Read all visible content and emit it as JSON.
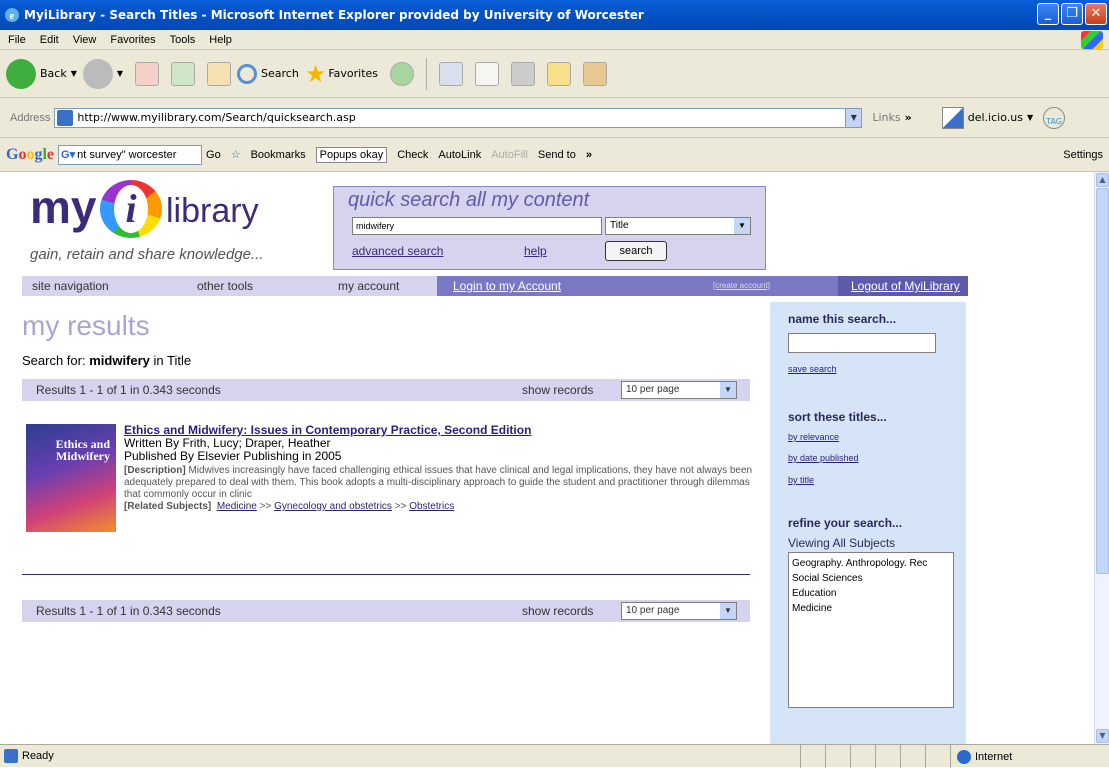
{
  "window": {
    "title": "MyiLibrary - Search Titles - Microsoft Internet Explorer provided by University of Worcester"
  },
  "menu": [
    "File",
    "Edit",
    "View",
    "Favorites",
    "Tools",
    "Help"
  ],
  "toolbar": {
    "back": "Back",
    "search": "Search",
    "favorites": "Favorites"
  },
  "address": {
    "label": "Address",
    "url": "http://www.myilibrary.com/Search/quicksearch.asp",
    "links": "Links",
    "delicious": "del.icio.us",
    "tag": "TAG"
  },
  "googlebar": {
    "logo": "Google",
    "query": "nt survey\" worcester",
    "go": "Go",
    "bookmarks": "Bookmarks",
    "popups": "Popups okay",
    "check": "Check",
    "autolink": "AutoLink",
    "autofill": "AutoFill",
    "sendto": "Send to",
    "settings": "Settings"
  },
  "logo": {
    "my": "my",
    "i": "i",
    "library": "library",
    "tagline": "gain, retain and share knowledge..."
  },
  "quicksearch": {
    "title": "quick search all my content",
    "query": "midwifery",
    "field": "Title",
    "advanced": "advanced search",
    "help": "help",
    "button": "search"
  },
  "nav": {
    "site": "site navigation",
    "tools": "other tools",
    "account": "my account",
    "login": "Login to my Account",
    "create": "[create account]",
    "logout": "Logout of MyiLibrary"
  },
  "results": {
    "heading": "my results",
    "search_prefix": "Search for:",
    "search_term": "midwifery",
    "search_suffix": "in Title",
    "summary": "Results 1 - 1 of 1 in 0.343 seconds",
    "show_records": "show records",
    "per_page": "10 per page"
  },
  "item": {
    "cover": "Ethics and Midwifery",
    "title": "Ethics and Midwifery: Issues in Contemporary Practice, Second Edition",
    "author": "Written By Frith, Lucy; Draper, Heather",
    "publisher": "Published By Elsevier Publishing in 2005",
    "desc_label": "[Description]",
    "description": "Midwives increasingly have faced challenging ethical issues that have clinical and legal implications, they have not always been adequately prepared to deal with them. This book adopts a multi-disciplinary approach to guide the student and practitioner through dilemmas that commonly occur in clinic",
    "subj_label": "[Related Subjects]",
    "subjects": [
      "Medicine",
      "Gynecology and obstetrics",
      "Obstetrics"
    ],
    "sep": ">>"
  },
  "sidebar": {
    "name_search": "name this search...",
    "save": "save search",
    "sort": "sort these titles...",
    "by_relevance": "by relevance",
    "by_date": "by date published",
    "by_title": "by title",
    "refine": "refine your search...",
    "viewing": "Viewing All Subjects",
    "subjects": [
      "Geography. Anthropology. Rec",
      "Social Sciences",
      "Education",
      "Medicine"
    ]
  },
  "status": {
    "text": "Ready",
    "zone": "Internet"
  }
}
